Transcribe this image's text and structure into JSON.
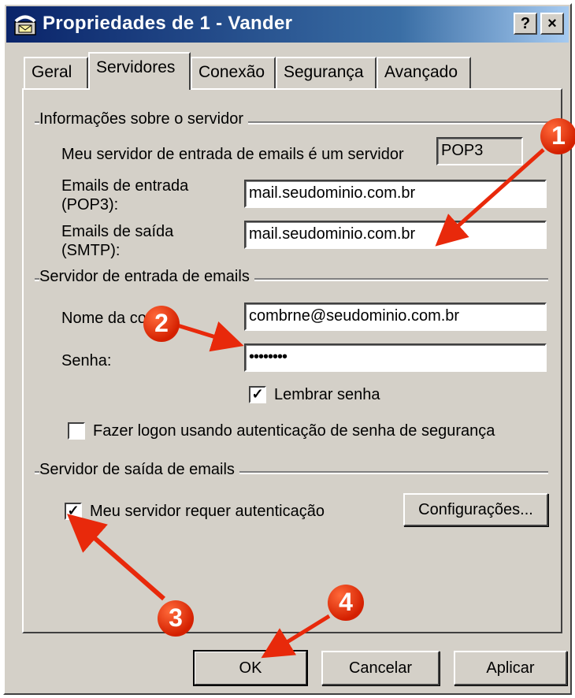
{
  "window": {
    "title": "Propriedades de 1 - Vander",
    "help_label": "?",
    "close_label": "×"
  },
  "tabs": [
    {
      "label": "Geral",
      "active": false
    },
    {
      "label": "Servidores",
      "active": true
    },
    {
      "label": "Conexão",
      "active": false
    },
    {
      "label": "Segurança",
      "active": false
    },
    {
      "label": "Avançado",
      "active": false
    }
  ],
  "server_info": {
    "group_title": "Informações sobre o servidor",
    "type_label": "Meu servidor de entrada de emails é um servidor",
    "type_value": "POP3",
    "incoming_label_1": "Emails de entrada",
    "incoming_label_2": "(POP3):",
    "incoming_value": "mail.seudominio.com.br",
    "outgoing_label_1": "Emails de saída",
    "outgoing_label_2": "(SMTP):",
    "outgoing_value": "mail.seudominio.com.br"
  },
  "incoming_server": {
    "group_title": "Servidor de entrada de emails",
    "account_label": "Nome da conta:",
    "account_value": "combrne@seudominio.com.br",
    "password_label": "Senha:",
    "password_value": "••••••••",
    "remember_label": "Lembrar senha",
    "remember_checked": true,
    "spa_label": "Fazer logon usando autenticação de senha de segurança",
    "spa_checked": false
  },
  "outgoing_server": {
    "group_title": "Servidor de saída de emails",
    "auth_label": "Meu servidor requer autenticação",
    "auth_checked": true,
    "settings_button": "Configurações..."
  },
  "buttons": {
    "ok": "OK",
    "cancel": "Cancelar",
    "apply": "Aplicar"
  },
  "callouts": [
    "1",
    "2",
    "3",
    "4"
  ],
  "colors": {
    "titlebar_start": "#0a246a",
    "titlebar_end": "#a6caf0",
    "dialog_face": "#d4d0c8",
    "annotation_red": "#e8290b"
  }
}
